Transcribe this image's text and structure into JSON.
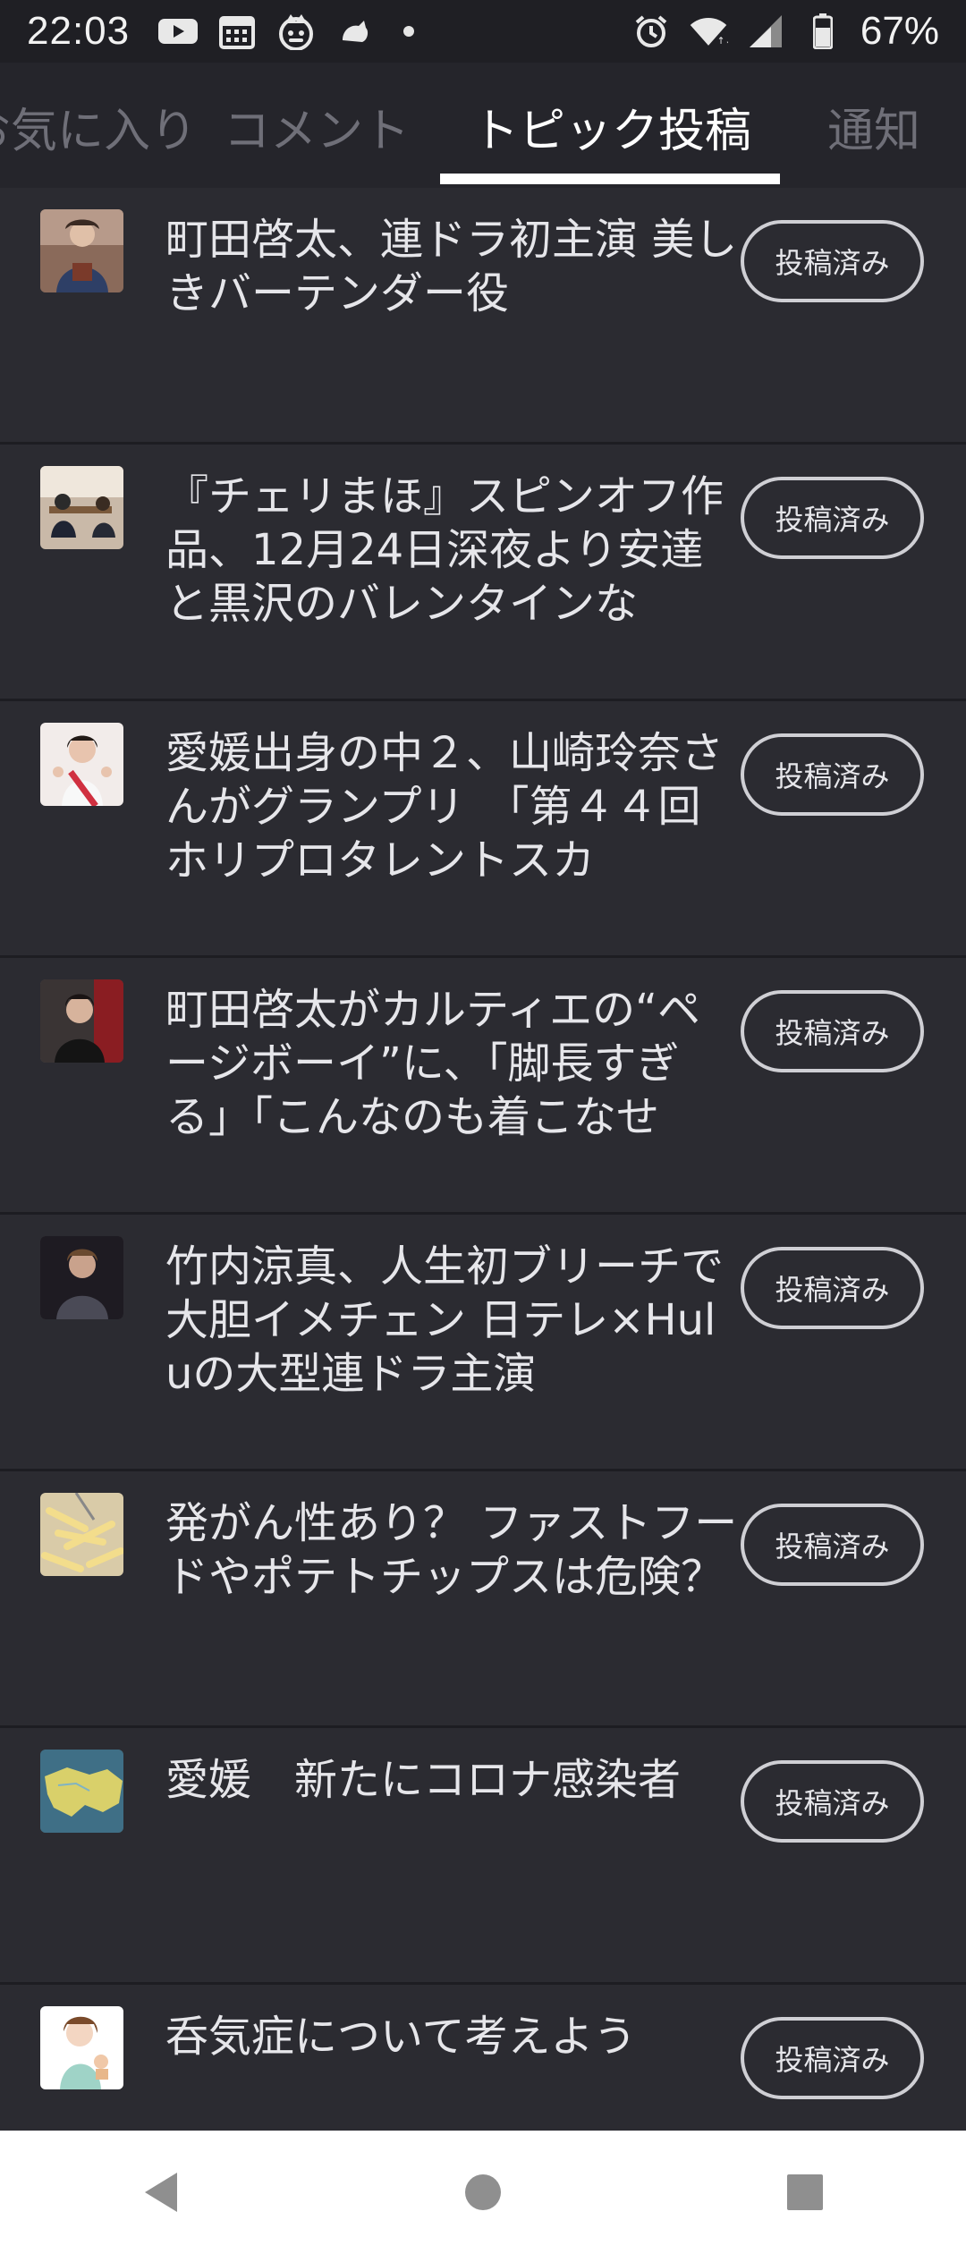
{
  "status_bar": {
    "time": "22:03",
    "battery_text": "67%",
    "left_icons": [
      "youtube-icon",
      "calendar-icon",
      "mascot-icon",
      "animal-icon"
    ],
    "right_icons": [
      "alarm-icon",
      "wifi-icon",
      "signal-icon",
      "battery-icon"
    ]
  },
  "tabs": [
    {
      "label": "お気に入り",
      "active": false
    },
    {
      "label": "コメント",
      "active": false
    },
    {
      "label": "トピック投稿",
      "active": true
    },
    {
      "label": "通知",
      "active": false
    }
  ],
  "items": [
    {
      "title": "町田啓太、連ドラ初主演 美しきバーテンダー役",
      "button": "投稿済み",
      "thumb": "man-portrait"
    },
    {
      "title": "『チェリまほ』スピンオフ作品、12月24日深夜より安達と黒沢のバレンタインな",
      "button": "投稿済み",
      "thumb": "office-scene"
    },
    {
      "title": "愛媛出身の中２、山崎玲奈さんがグランプリ　「第４４回ホリプロタレントスカ",
      "button": "投稿済み",
      "thumb": "girl-sash"
    },
    {
      "title": "町田啓太がカルティエの“ページボーイ”に、「脚長すぎる」「こんなのも着こなせ",
      "button": "投稿済み",
      "thumb": "man-smile"
    },
    {
      "title": "竹内涼真、人生初ブリーチで大胆イメチェン 日テレ×Huluの大型連ドラ主演",
      "button": "投稿済み",
      "thumb": "man-dark"
    },
    {
      "title": "発がん性あり？ ファストフードやポテトチップスは危険？",
      "button": "投稿済み",
      "thumb": "fries"
    },
    {
      "title": "愛媛　新たにコロナ感染者",
      "button": "投稿済み",
      "thumb": "map"
    },
    {
      "title": "呑気症について考えよう",
      "button": "投稿済み",
      "thumb": "illustration"
    }
  ],
  "nav": [
    "back-icon",
    "home-icon",
    "recents-icon"
  ]
}
